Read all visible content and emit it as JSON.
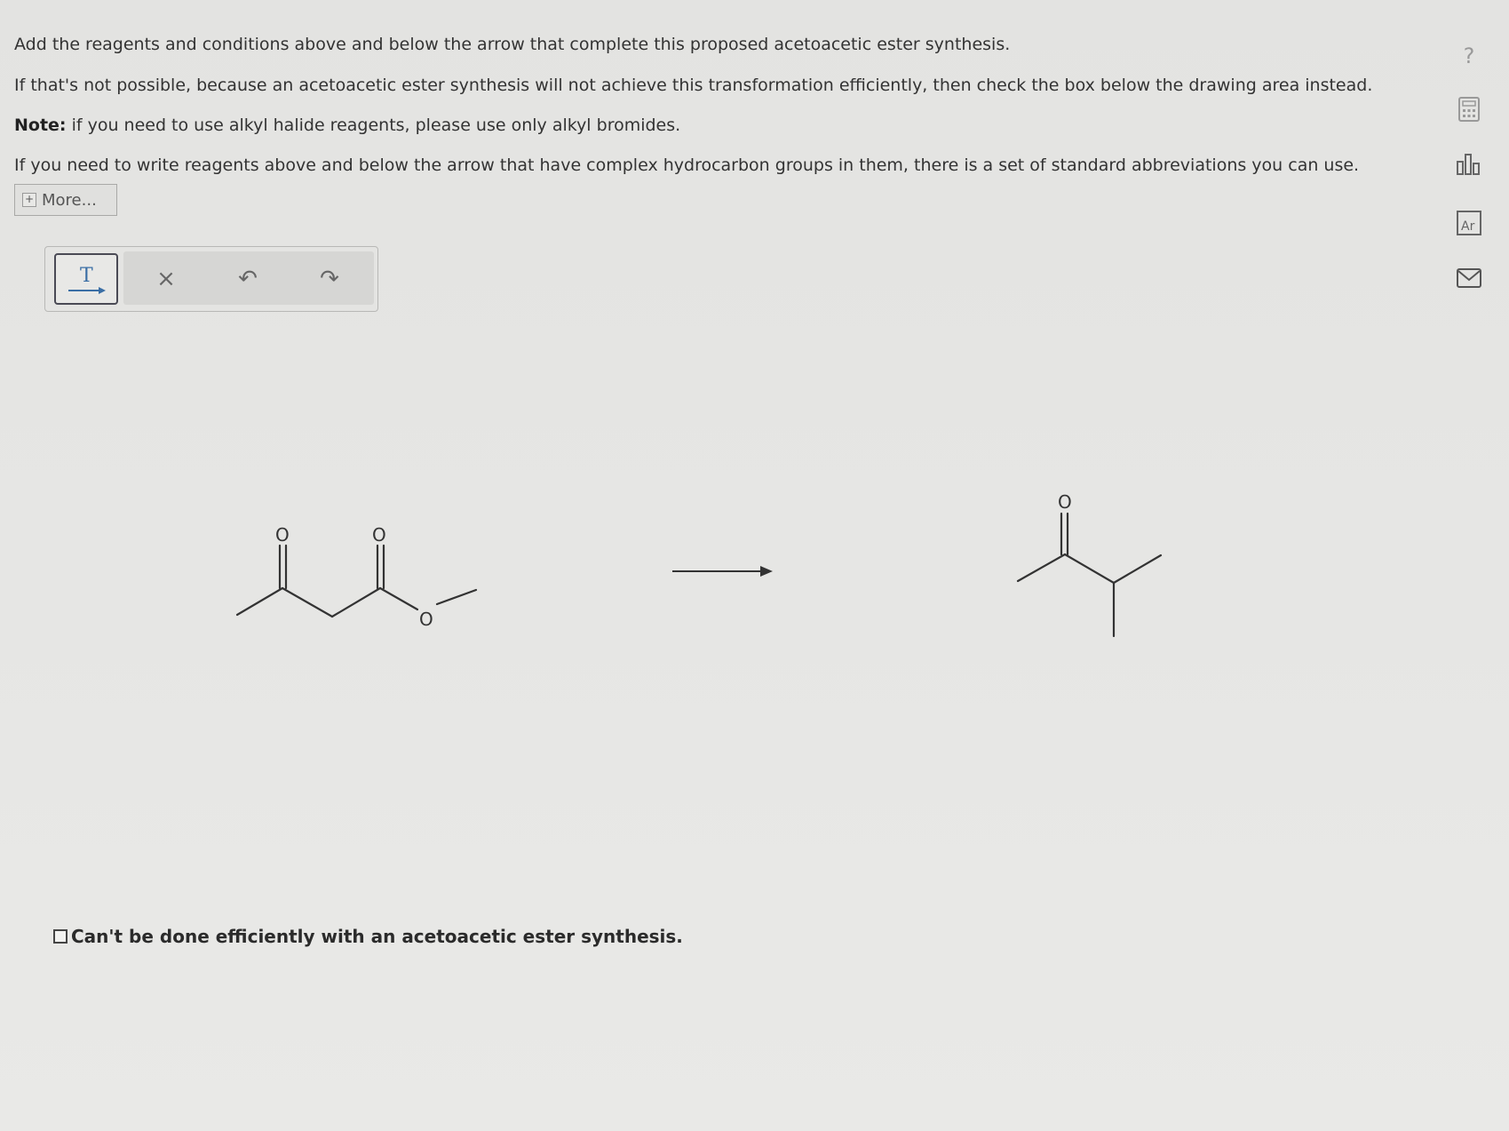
{
  "instructions": {
    "line1": "Add the reagents and conditions above and below the arrow that complete this proposed acetoacetic ester synthesis.",
    "line2": "If that's not possible, because an acetoacetic ester synthesis will not achieve this transformation efficiently, then check the box below the drawing area instead.",
    "note_label": "Note:",
    "note_text": " if you need to use alkyl halide reagents, please use only alkyl bromides.",
    "line4": "If you need to write reagents above and below the arrow that have complex hydrocarbon groups in them, there is a set of standard abbreviations you can use."
  },
  "more_button": {
    "icon": "+",
    "label": "More..."
  },
  "toolbar": {
    "arrow_tool_icon": "T",
    "clear_icon": "×",
    "undo_icon": "↶",
    "redo_icon": "↷"
  },
  "side_icons": {
    "help": "?",
    "calculator": "calculator-icon",
    "chart": "chart-icon",
    "periodic_table": "Ar",
    "mail": "mail-icon"
  },
  "molecules": {
    "reactant_atoms": [
      "O",
      "O",
      "O"
    ],
    "product_atoms": [
      "O"
    ]
  },
  "checkbox": {
    "label": "Can't be done efficiently with an acetoacetic ester synthesis.",
    "checked": false
  }
}
